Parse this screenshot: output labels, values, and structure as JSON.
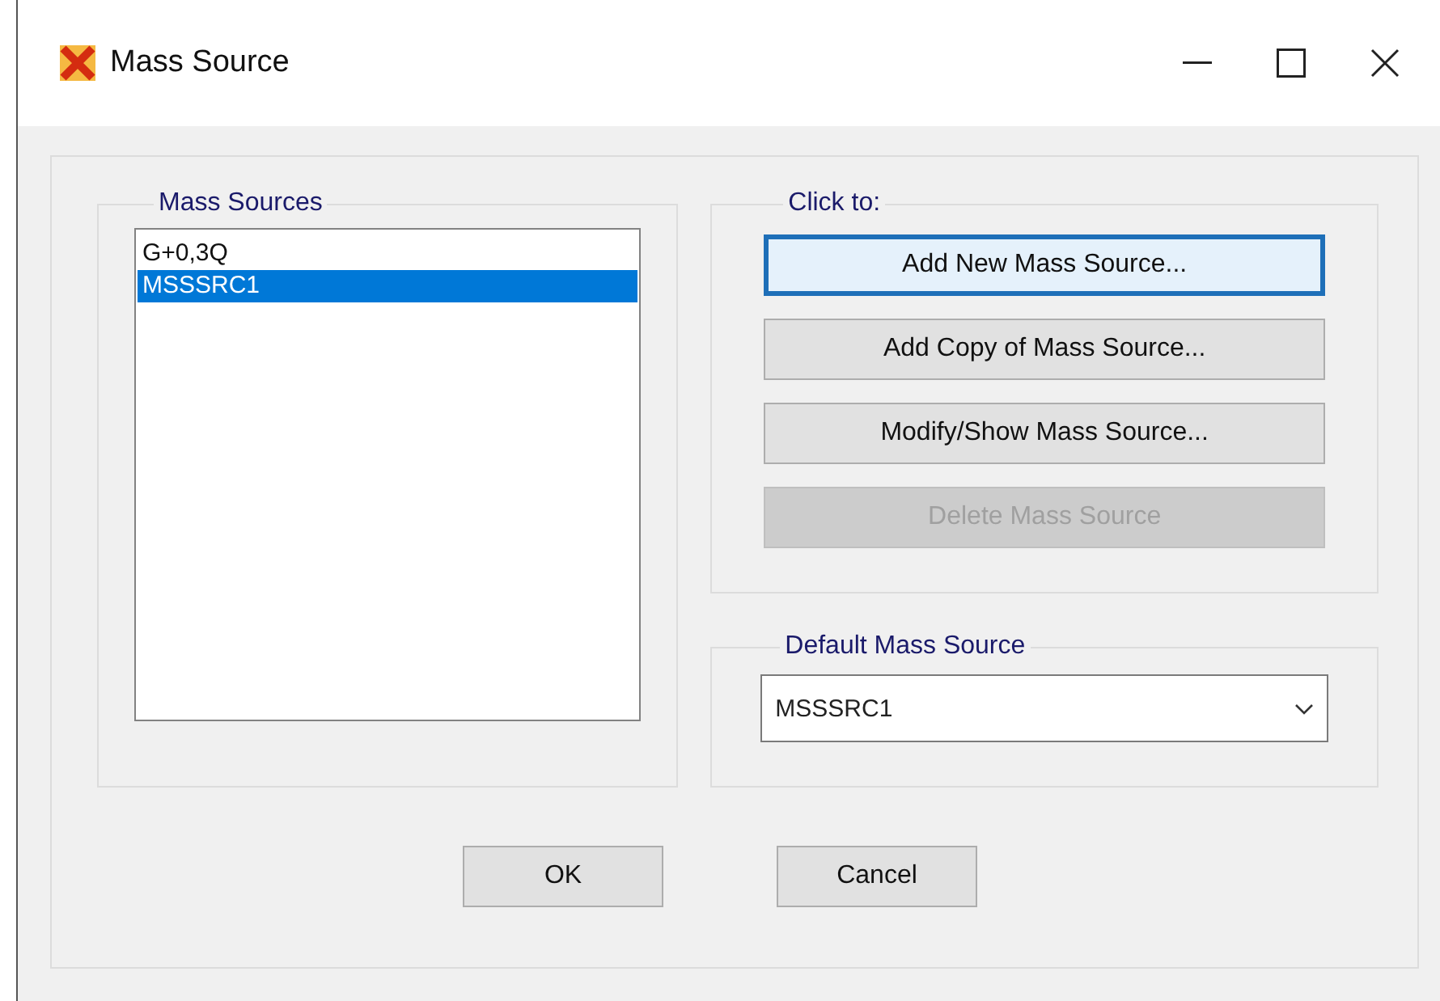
{
  "window": {
    "title": "Mass Source"
  },
  "mass_sources": {
    "label": "Mass Sources",
    "items": [
      {
        "name": "G+0,3Q",
        "selected": false
      },
      {
        "name": "MSSSRC1",
        "selected": true
      }
    ]
  },
  "click_to": {
    "label": "Click to:",
    "buttons": [
      {
        "label": "Add New Mass Source...",
        "focused": true,
        "disabled": false
      },
      {
        "label": "Add Copy of Mass Source...",
        "focused": false,
        "disabled": false
      },
      {
        "label": "Modify/Show Mass Source...",
        "focused": false,
        "disabled": false
      },
      {
        "label": "Delete Mass Source",
        "focused": false,
        "disabled": true
      }
    ]
  },
  "default_mass_source": {
    "label": "Default Mass Source",
    "value": "MSSSRC1"
  },
  "buttons": [
    "OK",
    "Cancel"
  ]
}
